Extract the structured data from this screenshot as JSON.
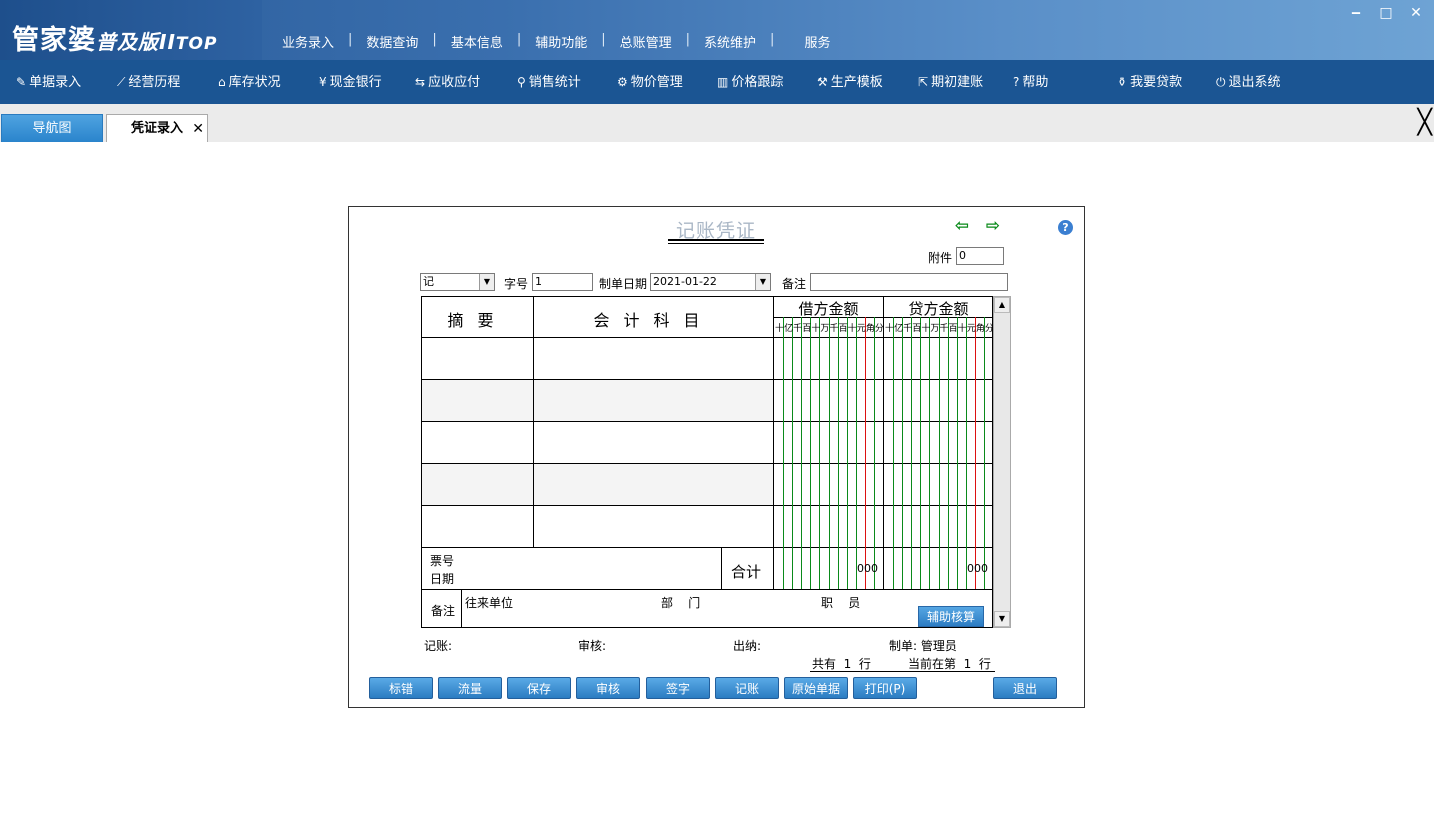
{
  "app": {
    "logo": {
      "main": "管家婆",
      "sub": "普及版",
      "roman": "II",
      "top": "TOP"
    },
    "top_menu": [
      "业务录入",
      "数据查询",
      "基本信息",
      "辅助功能",
      "总账管理",
      "系统维护",
      "服务"
    ],
    "top_menu_separator": "|",
    "window_controls": {
      "minimize": "‒",
      "maximize": "□",
      "close": "✕"
    }
  },
  "navbar": {
    "items": [
      {
        "label": "单据录入",
        "icon": "document-edit-icon",
        "glyph": "✎"
      },
      {
        "label": "经营历程",
        "icon": "line-chart-icon",
        "glyph": "⟋"
      },
      {
        "label": "库存状况",
        "icon": "home-icon",
        "glyph": "⌂"
      },
      {
        "label": "现金银行",
        "icon": "yen-icon",
        "glyph": "¥"
      },
      {
        "label": "应收应付",
        "icon": "exchange-arrows-icon",
        "glyph": "⇆"
      },
      {
        "label": "销售统计",
        "icon": "magnifier-icon",
        "glyph": "⚲"
      },
      {
        "label": "物价管理",
        "icon": "gear-icon",
        "glyph": "⚙"
      },
      {
        "label": "价格跟踪",
        "icon": "bar-chart-icon",
        "glyph": "▥"
      },
      {
        "label": "生产模板",
        "icon": "wrench-icon",
        "glyph": "⚒"
      },
      {
        "label": "期初建账",
        "icon": "external-link-icon",
        "glyph": "⇱"
      },
      {
        "label": "帮助",
        "icon": "question-icon",
        "glyph": "?"
      },
      {
        "label": "我要贷款",
        "icon": "money-bag-icon",
        "glyph": "⚱"
      },
      {
        "label": "退出系统",
        "icon": "power-icon",
        "glyph": "⏻"
      }
    ]
  },
  "tabs": [
    {
      "label": "导航图",
      "active": false
    },
    {
      "label": "凭证录入",
      "active": true,
      "close": "✕"
    }
  ],
  "close_all": "╳",
  "voucher": {
    "title": "记账凭证",
    "prev_arrow": "⇦",
    "next_arrow": "⇨",
    "help": "?",
    "attachment_label": "附件",
    "attachment_value": "0",
    "type_value": "记",
    "number_label": "字号",
    "number_value": "1",
    "date_label": "制单日期",
    "date_value": "2021-01-22",
    "memo_label": "备注",
    "memo_value": "",
    "columns": {
      "summary": "摘要",
      "account": "会计科目",
      "debit": "借方金额",
      "credit": "贷方金额",
      "digits": [
        "十",
        "亿",
        "千",
        "百",
        "十",
        "万",
        "千",
        "百",
        "十",
        "元",
        "角",
        "分"
      ]
    },
    "rows": [
      {
        "summary": "",
        "account": "",
        "debit": "",
        "credit": ""
      },
      {
        "summary": "",
        "account": "",
        "debit": "",
        "credit": ""
      },
      {
        "summary": "",
        "account": "",
        "debit": "",
        "credit": ""
      },
      {
        "summary": "",
        "account": "",
        "debit": "",
        "credit": ""
      },
      {
        "summary": "",
        "account": "",
        "debit": "",
        "credit": ""
      }
    ],
    "ticket_no_label": "票号",
    "ticket_date_label": "日期",
    "total_label": "合计",
    "debit_total": "000",
    "credit_total": "000",
    "footer_memo_label": "备注",
    "partner_label": "往来单位",
    "dept_label": "部    门",
    "staff_label": "职    员",
    "aux_button": "辅助核算",
    "bookkeeper_label": "记账:",
    "auditor_label": "审核:",
    "cashier_label": "出纳:",
    "maker_label": "制单: 管理员",
    "total_rows": "共有  1  行",
    "current_row": "当前在第  1  行"
  },
  "buttons": [
    "标错",
    "流量",
    "保存",
    "审核",
    "签字",
    "记账",
    "原始单据",
    "打印(P)",
    "退出"
  ],
  "colors": {
    "top_bar": "#2a5c9a",
    "nav_bar": "#1b5593",
    "tab_active_blue": "#2a84cc",
    "grid_green": "#0a8a1a",
    "grid_red": "#dd1111",
    "button_blue": "#2b7cc2"
  }
}
